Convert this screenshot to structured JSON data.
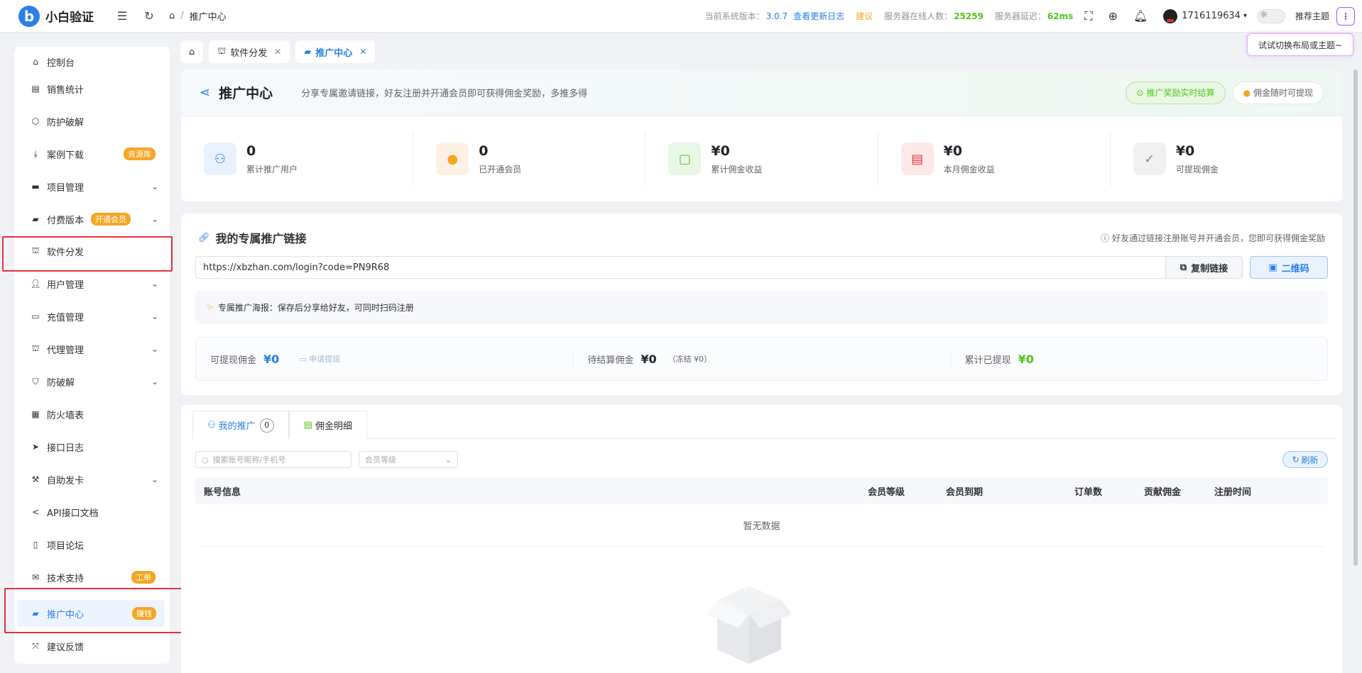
{
  "header": {
    "logo_letter": "b",
    "app_name": "小白验证",
    "breadcrumb": [
      "推广中心"
    ],
    "version_label": "当前系统版本：",
    "version": "3.0.7",
    "changelog": "查看更新日志",
    "suggest": "建议",
    "online_label": "服务器在线人数：",
    "online": "25259",
    "latency_label": "服务器延迟：",
    "latency": "62ms",
    "username": "1716119634",
    "theme_btn": "推荐主题",
    "more": "⋮",
    "tooltip": "试试切换布局或主题~"
  },
  "sidebar": {
    "items": [
      {
        "label": "控制台",
        "icon": "home-icon"
      },
      {
        "label": "销售统计",
        "icon": "chart-icon"
      },
      {
        "label": "防护破解",
        "icon": "shield-icon"
      },
      {
        "label": "案例下载",
        "icon": "download-icon",
        "badge": "资源库"
      },
      {
        "label": "项目管理",
        "icon": "monitor-icon",
        "chevron": true
      },
      {
        "label": "付费版本",
        "icon": "thumb-icon",
        "badge2": "开通会员",
        "chevron": true
      },
      {
        "label": "软件分发",
        "icon": "sitemap-icon"
      },
      {
        "label": "用户管理",
        "icon": "user-icon",
        "chevron": true
      },
      {
        "label": "充值管理",
        "icon": "card-icon",
        "chevron": true
      },
      {
        "label": "代理管理",
        "icon": "sitemap-icon",
        "chevron": true
      },
      {
        "label": "防破解",
        "icon": "shield-check-icon",
        "chevron": true
      },
      {
        "label": "防火墙表",
        "icon": "grid-icon"
      },
      {
        "label": "接口日志",
        "icon": "send-icon"
      },
      {
        "label": "自助发卡",
        "icon": "tools-icon",
        "chevron": true
      },
      {
        "label": "API接口文档",
        "icon": "share-icon"
      },
      {
        "label": "项目论坛",
        "icon": "tablet-icon"
      },
      {
        "label": "技术支持",
        "icon": "mail-icon",
        "badge": "工单"
      },
      {
        "label": "推广中心",
        "icon": "thumb-icon",
        "badge": "赚钱",
        "active": true
      },
      {
        "label": "建议反馈",
        "icon": "expand-icon"
      }
    ]
  },
  "tabs": [
    {
      "label": "",
      "icon": "home-icon"
    },
    {
      "label": "软件分发",
      "icon": "sitemap-icon",
      "closable": true
    },
    {
      "label": "推广中心",
      "icon": "thumb-icon",
      "closable": true,
      "active": true
    }
  ],
  "hero": {
    "title": "推广中心",
    "desc": "分享专属邀请链接，好友注册并开通会员即可获得佣金奖励，多推多得",
    "pill_green": "推广奖励实时结算",
    "pill_white": "佣金随时可提现"
  },
  "stats": [
    {
      "value": "0",
      "label": "累计推广用户",
      "icon": "user-icon",
      "bg": "#e8f2fd",
      "fg": "#2b7fe5"
    },
    {
      "value": "0",
      "label": "已开通会员",
      "icon": "member-icon",
      "bg": "#fdf1e3",
      "fg": "#f5a623"
    },
    {
      "value": "¥0",
      "label": "累计佣金收益",
      "icon": "wallet-icon",
      "bg": "#e9f7e6",
      "fg": "#52c41a"
    },
    {
      "value": "¥0",
      "label": "本月佣金收益",
      "icon": "document-icon",
      "bg": "#fde9ea",
      "fg": "#e5323a"
    },
    {
      "value": "¥0",
      "label": "可提现佣金",
      "icon": "check-circle-icon",
      "bg": "#f0f1f3",
      "fg": "#888888"
    }
  ],
  "link": {
    "title": "我的专属推广链接",
    "note": "好友通过链接注册账号并开通会员，您即可获得佣金奖励",
    "url": "https://xbzhan.com/login?code=PN9R68",
    "copy_btn": "复制链接",
    "qr_btn": "二维码",
    "poster": "专属推广海报：保存后分享给好友，可同时扫码注册"
  },
  "commission": {
    "withdrawable_label": "可提现佣金",
    "withdrawable": "¥0",
    "apply": "申请提现",
    "pending_label": "待结算佣金",
    "pending": "¥0",
    "frozen": "（冻结 ¥0）",
    "withdrawn_label": "累计已提现",
    "withdrawn": "¥0"
  },
  "list": {
    "tab1": "我的推广",
    "tab1_count": "0",
    "tab2": "佣金明细",
    "search_placeholder": "搜索账号昵称/手机号",
    "level_placeholder": "会员等级",
    "refresh": "刷新",
    "columns": [
      "账号信息",
      "会员等级",
      "会员到期",
      "订单数",
      "贡献佣金",
      "注册时间"
    ],
    "empty": "暂无数据"
  }
}
